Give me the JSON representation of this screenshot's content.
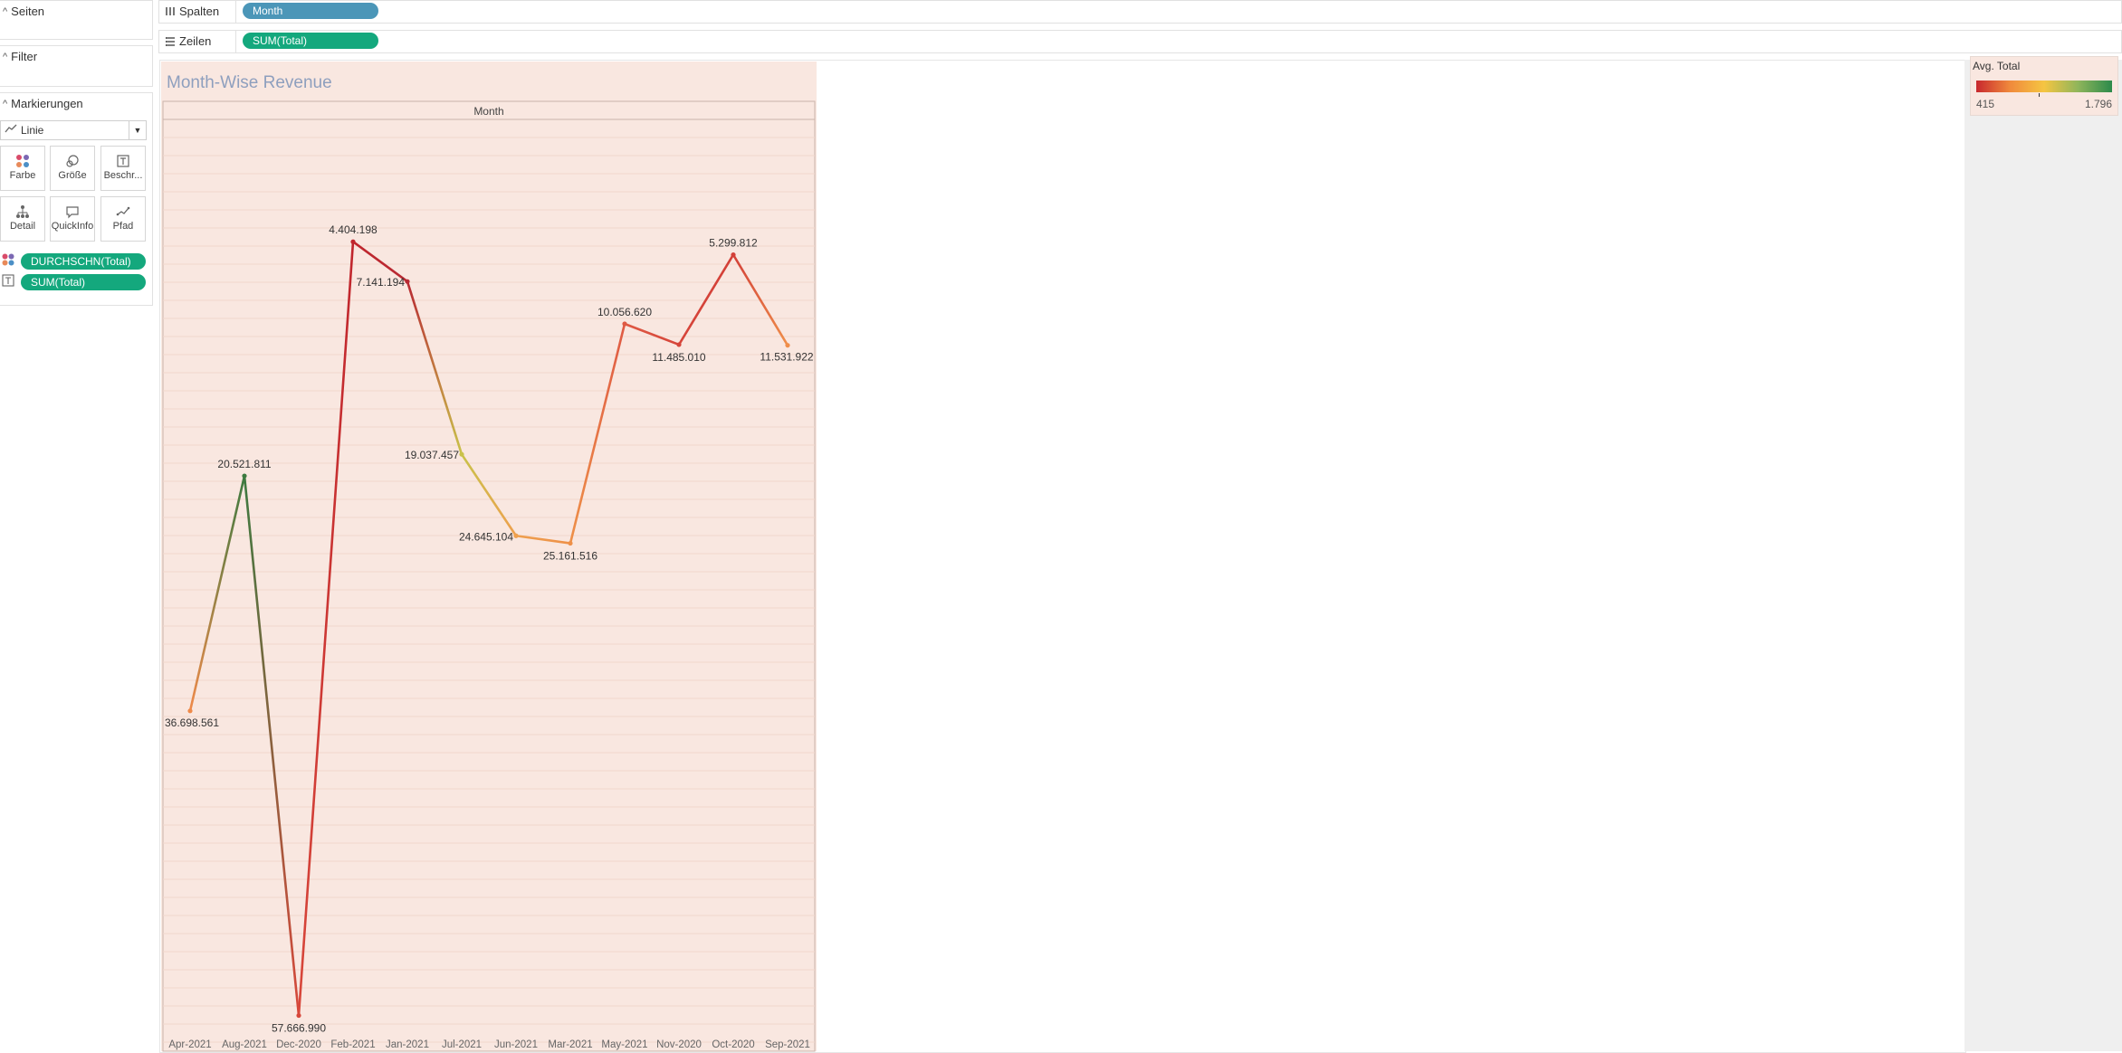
{
  "left_pane": {
    "pages_title": "Seiten",
    "filter_title": "Filter",
    "marks_title": "Markierungen",
    "mark_type": "Linie",
    "mark_buttons": {
      "color": "Farbe",
      "size": "Größe",
      "label": "Beschr...",
      "detail": "Detail",
      "tooltip": "QuickInfo",
      "path": "Pfad"
    },
    "mark_fields": {
      "color_field": "DURCHSCHN(Total)",
      "label_field": "SUM(Total)"
    }
  },
  "shelves": {
    "columns_label": "Spalten",
    "columns_pill": "Month",
    "rows_label": "Zeilen",
    "rows_pill": "SUM(Total)"
  },
  "legend": {
    "title": "Avg. Total",
    "min_label": "415",
    "max_label": "1.796",
    "gradient_colors": [
      "#c8282e",
      "#f08a3c",
      "#f5c542",
      "#8fb55b",
      "#2c8a4b"
    ]
  },
  "colors": {
    "sheet_bg": "#f9e7e0",
    "title": "#8e9fbe",
    "pill_blue": "#4b96b8",
    "pill_green": "#14a87d"
  },
  "chart_data": {
    "type": "line",
    "title": "Month-Wise Revenue",
    "column_header": "Month",
    "xlabel": "",
    "ylabel": "",
    "categories": [
      "Apr-2021",
      "Aug-2021",
      "Dec-2020",
      "Feb-2021",
      "Jan-2021",
      "Jul-2021",
      "Jun-2021",
      "Mar-2021",
      "May-2021",
      "Nov-2020",
      "Oct-2020",
      "Sep-2021"
    ],
    "series": [
      {
        "values": [
          36698561,
          20521811,
          57666990,
          4404198,
          7141194,
          19037457,
          24645104,
          25161516,
          10056620,
          11485010,
          5299812,
          11531922
        ],
        "value_labels": [
          "36.698.561",
          "20.521.811",
          "57.666.990",
          "4.404.198",
          "7.141.194",
          "19.037.457",
          "24.645.104",
          "25.161.516",
          "10.056.620",
          "11.485.010",
          "5.299.812",
          "11.531.922"
        ],
        "point_colors": [
          "#ef8a4a",
          "#3d7a40",
          "#d8473a",
          "#c0262d",
          "#b82a33",
          "#c9c24a",
          "#eea04e",
          "#ee9048",
          "#df5a44",
          "#d6453a",
          "#d34038",
          "#ef8e4a"
        ]
      }
    ],
    "y_axis": "reversed, hidden",
    "ylim": [
      0,
      60000000
    ],
    "grid": false,
    "legend": "top-right"
  }
}
